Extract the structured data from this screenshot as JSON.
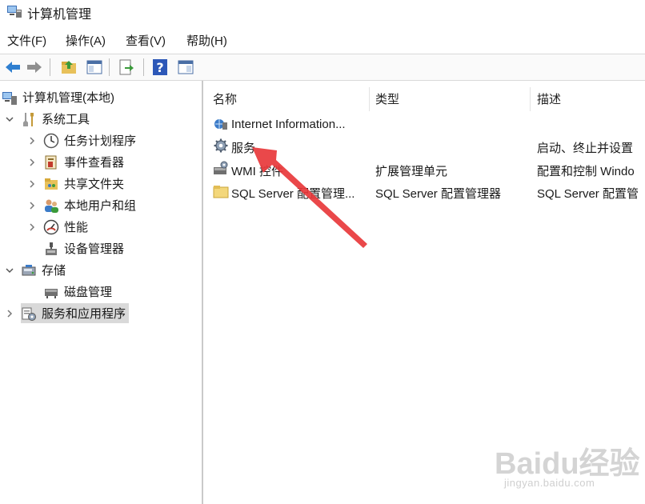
{
  "window": {
    "title": "计算机管理"
  },
  "menu": {
    "items": [
      "文件(F)",
      "操作(A)",
      "查看(V)",
      "帮助(H)"
    ]
  },
  "toolbar": {
    "buttons": [
      "back-icon",
      "forward-icon",
      "up-folder-icon",
      "show-hide-tree-icon",
      "export-list-icon",
      "help-icon",
      "action-pane-icon"
    ]
  },
  "tree": {
    "items": [
      {
        "label": "计算机管理(本地)",
        "icon": "computer-management-icon"
      },
      {
        "label": "系统工具",
        "icon": "tools-icon",
        "expander": "expanded"
      },
      {
        "label": "任务计划程序",
        "icon": "clock-icon",
        "expander": "collapsed"
      },
      {
        "label": "事件查看器",
        "icon": "event-viewer-icon",
        "expander": "collapsed"
      },
      {
        "label": "共享文件夹",
        "icon": "shared-folder-icon",
        "expander": "collapsed"
      },
      {
        "label": "本地用户和组",
        "icon": "users-icon",
        "expander": "collapsed"
      },
      {
        "label": "性能",
        "icon": "performance-icon",
        "expander": "collapsed"
      },
      {
        "label": "设备管理器",
        "icon": "device-manager-icon"
      },
      {
        "label": "存储",
        "icon": "storage-icon",
        "expander": "expanded"
      },
      {
        "label": "磁盘管理",
        "icon": "disk-icon"
      },
      {
        "label": "服务和应用程序",
        "icon": "services-apps-icon",
        "expander": "collapsed",
        "selected": true
      }
    ]
  },
  "list": {
    "columns": [
      "名称",
      "类型",
      "描述"
    ],
    "rows": [
      {
        "name": "Internet Information...",
        "type": "",
        "description": "",
        "icon": "iis-icon"
      },
      {
        "name": "服务",
        "type": "",
        "description": "启动、终止并设置",
        "icon": "services-gear-icon"
      },
      {
        "name": "WMI 控件",
        "type": "扩展管理单元",
        "description": "配置和控制 Windo",
        "icon": "wmi-icon"
      },
      {
        "name": "SQL Server 配置管理...",
        "type": "SQL Server 配置管理器",
        "description": "SQL Server 配置管",
        "icon": "sql-folder-icon"
      }
    ]
  },
  "annotation": {
    "color": "#e8383b"
  },
  "watermark": {
    "logo": "Baidu经验",
    "url": "jingyan.baidu.com"
  },
  "colors": {
    "accent": "#1f7acc",
    "selection": "#d9d9d9",
    "arrow": "#e8383b"
  }
}
